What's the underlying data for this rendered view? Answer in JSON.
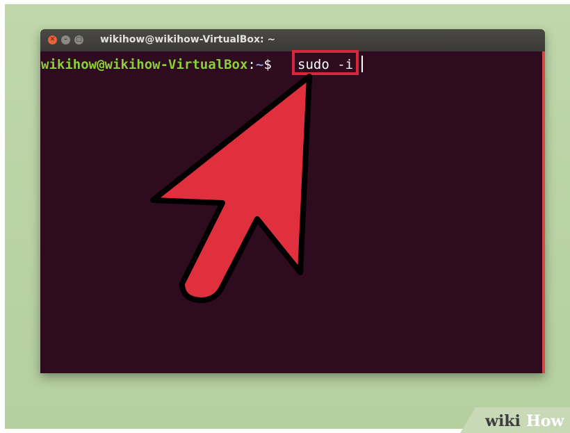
{
  "window": {
    "title": "wikihow@wikihow-VirtualBox: ~",
    "buttons": {
      "close_icon": "close-icon",
      "minimize_icon": "minimize-icon",
      "maximize_icon": "maximize-icon"
    }
  },
  "terminal": {
    "prompt_user": "wikihow@wikihow-VirtualBox",
    "prompt_sep": ":",
    "prompt_path": "~",
    "prompt_sign": "$",
    "command": "sudo -i"
  },
  "annotation": {
    "arrow_color": "#e0303d",
    "highlight_color": "#d8273a"
  },
  "watermark": {
    "wiki": "wiki",
    "how": "How"
  },
  "colors": {
    "background": "#b9d2a4",
    "terminal_bg": "#2e0b1f",
    "prompt_user": "#8ad137",
    "prompt_path": "#7f9fd0"
  }
}
